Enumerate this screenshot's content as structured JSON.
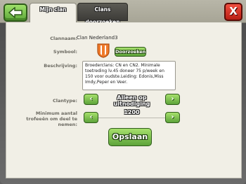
{
  "header": {
    "tabs": [
      {
        "label": "Mijn clan",
        "active": true
      },
      {
        "label": "Clans doorzoeken",
        "active": false
      }
    ],
    "close_label": "X"
  },
  "form": {
    "clan_name_label": "Clannaam:",
    "clan_name_value": "Clan Nederland3",
    "symbol_label": "Symbool:",
    "browse_label": "Doorzoeken",
    "description_label": "Beschrijving:",
    "description_value": "Broederclans: CN en CN2. Minimale toetreding lv.45 doneer 75 p/week en 150 voor oudste.Leiding: Edonis,Miss Imdy,Peper en Veer.",
    "clantype_label": "Clantype:",
    "clantype_value": "Alleen op uitnodiging",
    "trophies_label": "Minimum aantal trofeeën om deel te nemen:",
    "trophies_value": "1200",
    "save_label": "Opslaan"
  },
  "colors": {
    "accent_green": "#5da33a",
    "close_red": "#b81e14",
    "panel_bg": "#f1efe6"
  }
}
